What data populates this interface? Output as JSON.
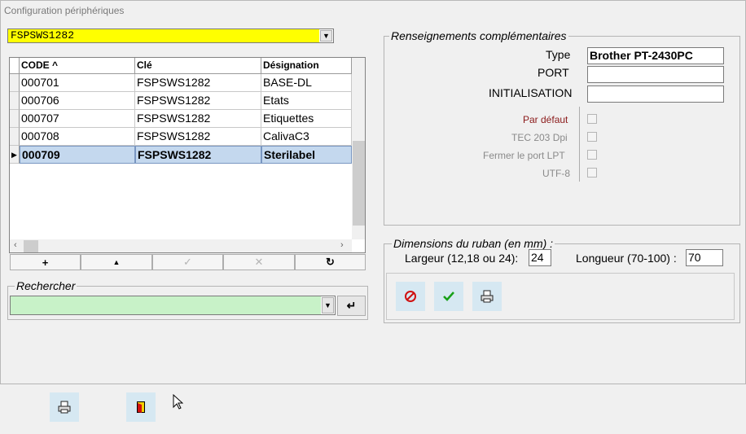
{
  "window": {
    "title": "Configuration périphériques"
  },
  "device_select": {
    "value": "FSPSWS1282"
  },
  "grid": {
    "columns": [
      "CODE  ^",
      "Clé",
      "Désignation"
    ],
    "rows": [
      {
        "code": "000701",
        "cle": "FSPSWS1282",
        "designation": "BASE-DL"
      },
      {
        "code": "000706",
        "cle": "FSPSWS1282",
        "designation": "Etats"
      },
      {
        "code": "000707",
        "cle": "FSPSWS1282",
        "designation": "Etiquettes"
      },
      {
        "code": "000708",
        "cle": "FSPSWS1282",
        "designation": "CalivaC3"
      },
      {
        "code": "000709",
        "cle": "FSPSWS1282",
        "designation": "Sterilabel"
      }
    ],
    "selected_row": 4
  },
  "navbar": {
    "add": "+",
    "up": "▲",
    "validate": "✓",
    "cancel": "✕",
    "refresh": "↻"
  },
  "search": {
    "legend": "Rechercher",
    "value": "",
    "enter_icon": "↵"
  },
  "details": {
    "legend": "Renseignements complémentaires",
    "type_label": "Type",
    "type_value": "Brother PT-2430PC",
    "port_label": "PORT",
    "port_value": "",
    "init_label": "INITIALISATION",
    "init_value": "",
    "par_defaut": "Par défaut",
    "tec_203": "TEC 203 Dpi",
    "fermer_port": "Fermer le port LPT",
    "utf8": "UTF-8"
  },
  "ribbon": {
    "legend": "Dimensions du ruban  (en mm) :",
    "largeur_label": "Largeur (12,18 ou 24):",
    "largeur_value": "24",
    "longueur_label": "Longueur (70-100) :",
    "longueur_value": "70"
  },
  "colors": {
    "device_bg": "#ffff00",
    "search_bg": "#c8f2c8",
    "selected_row": "#c4d8ee",
    "par_defaut": "#8b1a1a"
  },
  "icons": [
    "cancel-icon",
    "validate-icon",
    "print-icon",
    "exit-icon"
  ]
}
